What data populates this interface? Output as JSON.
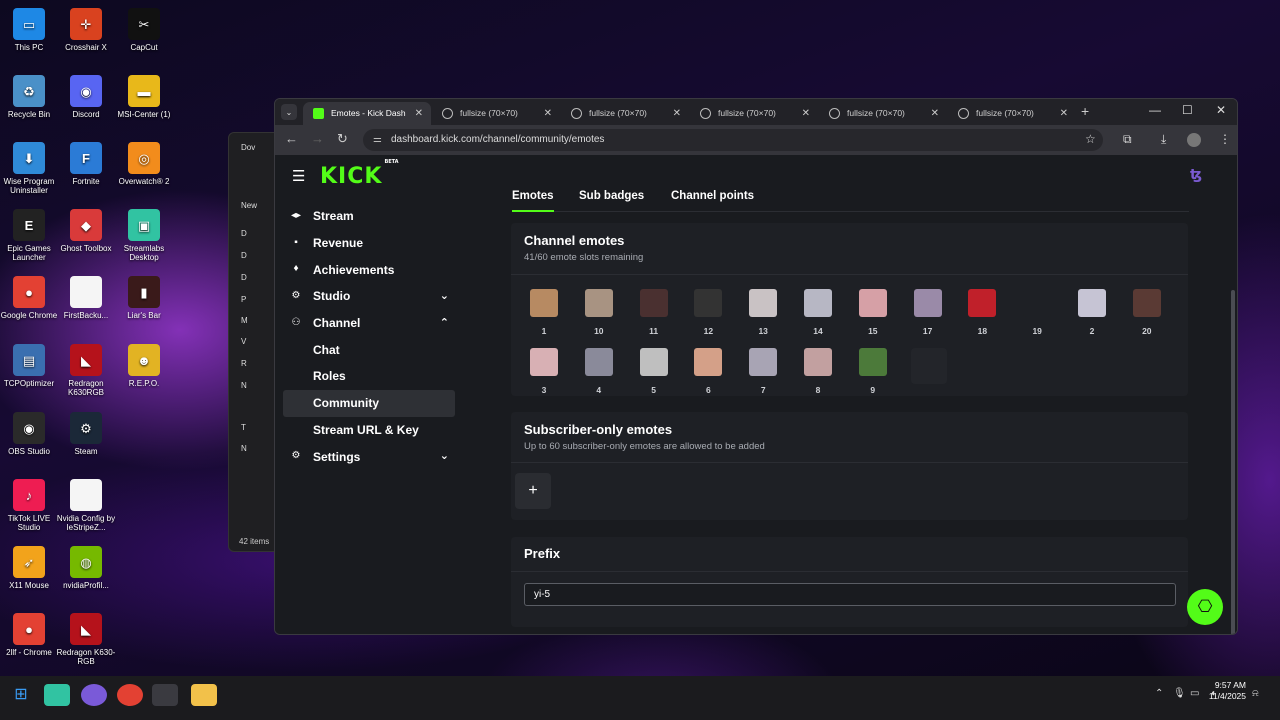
{
  "desktop": {
    "icons": [
      {
        "label": "This PC",
        "color": "#1e88e5",
        "glyph": "▭"
      },
      {
        "label": "Crosshair X",
        "color": "#d9421f",
        "glyph": "✛"
      },
      {
        "label": "CapCut",
        "color": "#111111",
        "glyph": "✂"
      },
      {
        "label": "Recycle Bin",
        "color": "#4a90c8",
        "glyph": "♻"
      },
      {
        "label": "Discord",
        "color": "#5865f2",
        "glyph": "◉"
      },
      {
        "label": "MSI-Center (1)",
        "color": "#e8b81a",
        "glyph": "▬"
      },
      {
        "label": "Wise Program Uninstaller",
        "color": "#2f8ad8",
        "glyph": "⬇"
      },
      {
        "label": "Fortnite",
        "color": "#2b7bd6",
        "glyph": "F"
      },
      {
        "label": "Overwatch® 2",
        "color": "#f28c1c",
        "glyph": "◎"
      },
      {
        "label": "Epic Games Launcher",
        "color": "#222222",
        "glyph": "E"
      },
      {
        "label": "Ghost Toolbox",
        "color": "#d93a3a",
        "glyph": "◆"
      },
      {
        "label": "Streamlabs Desktop",
        "color": "#31c3a2",
        "glyph": "▣"
      },
      {
        "label": "Google Chrome",
        "color": "#e34133",
        "glyph": "●"
      },
      {
        "label": "FirstBacku...",
        "color": "#f5f5f5",
        "glyph": ""
      },
      {
        "label": "Liar's Bar",
        "color": "#3a1a1a",
        "glyph": "▮"
      },
      {
        "label": "TCPOptimizer",
        "color": "#3a6fb0",
        "glyph": "▤"
      },
      {
        "label": "Redragon K630RGB",
        "color": "#b5121b",
        "glyph": "◣"
      },
      {
        "label": "R.E.P.O.",
        "color": "#e2b323",
        "glyph": "☻"
      },
      {
        "label": "OBS Studio",
        "color": "#2a2a2a",
        "glyph": "◉"
      },
      {
        "label": "Steam",
        "color": "#1b2838",
        "glyph": "⚙"
      },
      {
        "label": "TikTok LIVE Studio",
        "color": "#ee1d52",
        "glyph": "♪"
      },
      {
        "label": "Nvidia Config by IeStripeZ...",
        "color": "#f5f5f5",
        "glyph": ""
      },
      {
        "label": "X11 Mouse",
        "color": "#f2a31b",
        "glyph": "➶"
      },
      {
        "label": "nvidiaProfil...",
        "color": "#76b900",
        "glyph": "◍"
      },
      {
        "label": "2llf - Chrome",
        "color": "#e34133",
        "glyph": "●"
      },
      {
        "label": "Redragon K630-RGB",
        "color": "#b5121b",
        "glyph": "◣"
      }
    ]
  },
  "explorer": {
    "rows": [
      "Dov",
      "New",
      "D",
      "D",
      "D",
      "P",
      "M",
      "V",
      "R",
      "N",
      "T",
      "N"
    ],
    "status": "42 items"
  },
  "browser": {
    "tabs": [
      {
        "title": "Emotes - Kick Dash",
        "active": true,
        "favicon": "kick"
      },
      {
        "title": "fullsize (70×70)",
        "active": false,
        "favicon": "globe"
      },
      {
        "title": "fullsize (70×70)",
        "active": false,
        "favicon": "globe"
      },
      {
        "title": "fullsize (70×70)",
        "active": false,
        "favicon": "globe"
      },
      {
        "title": "fullsize (70×70)",
        "active": false,
        "favicon": "globe"
      },
      {
        "title": "fullsize (70×70)",
        "active": false,
        "favicon": "globe"
      }
    ],
    "url": "dashboard.kick.com/channel/community/emotes"
  },
  "kick": {
    "logo": "KICK",
    "logo_badge": "BETA",
    "sidebar": [
      {
        "label": "Stream",
        "icon": "◂▸",
        "chevron": ""
      },
      {
        "label": "Revenue",
        "icon": "▪",
        "chevron": ""
      },
      {
        "label": "Achievements",
        "icon": "♦",
        "chevron": ""
      },
      {
        "label": "Studio",
        "icon": "⚙",
        "chevron": "⌄"
      },
      {
        "label": "Channel",
        "icon": "⚇",
        "chevron": "⌃"
      },
      {
        "label": "Chat",
        "icon": "",
        "chevron": ""
      },
      {
        "label": "Roles",
        "icon": "",
        "chevron": ""
      },
      {
        "label": "Community",
        "icon": "",
        "chevron": "",
        "selected": true
      },
      {
        "label": "Stream URL & Key",
        "icon": "",
        "chevron": ""
      },
      {
        "label": "Settings",
        "icon": "⚙",
        "chevron": "⌄"
      }
    ],
    "subtabs": [
      "Emotes",
      "Sub badges",
      "Channel points"
    ],
    "channel_emotes": {
      "title": "Channel emotes",
      "subtitle": "41/60 emote slots remaining",
      "emotes": [
        {
          "num": "1",
          "color": "#b78a62"
        },
        {
          "num": "10",
          "color": "#a89382"
        },
        {
          "num": "11",
          "color": "#4a3030"
        },
        {
          "num": "12",
          "color": "#333333"
        },
        {
          "num": "13",
          "color": "#c9c2c4"
        },
        {
          "num": "14",
          "color": "#b7b7c4"
        },
        {
          "num": "15",
          "color": "#d6a0a6"
        },
        {
          "num": "17",
          "color": "#9a8aa8"
        },
        {
          "num": "18",
          "color": "#c0202a"
        },
        {
          "num": "19",
          "color": "#1e2025"
        },
        {
          "num": "2",
          "color": "#c6c4d4"
        },
        {
          "num": "20",
          "color": "#5a3a34"
        },
        {
          "num": "3",
          "color": "#d8b0b4"
        },
        {
          "num": "4",
          "color": "#8a8a9a"
        },
        {
          "num": "5",
          "color": "#bfbfbf"
        },
        {
          "num": "6",
          "color": "#d4a088"
        },
        {
          "num": "7",
          "color": "#a8a4b4"
        },
        {
          "num": "8",
          "color": "#c2a0a0"
        },
        {
          "num": "9",
          "color": "#4c7a3a"
        }
      ]
    },
    "subscriber_emotes": {
      "title": "Subscriber-only emotes",
      "subtitle": "Up to 60 subscriber-only emotes are allowed to be added",
      "add_label": "+"
    },
    "prefix": {
      "title": "Prefix",
      "value": "yi-5"
    },
    "accent": "#53fc18"
  },
  "taskbar": {
    "time": "9:57 AM",
    "date": "11/4/2025"
  }
}
